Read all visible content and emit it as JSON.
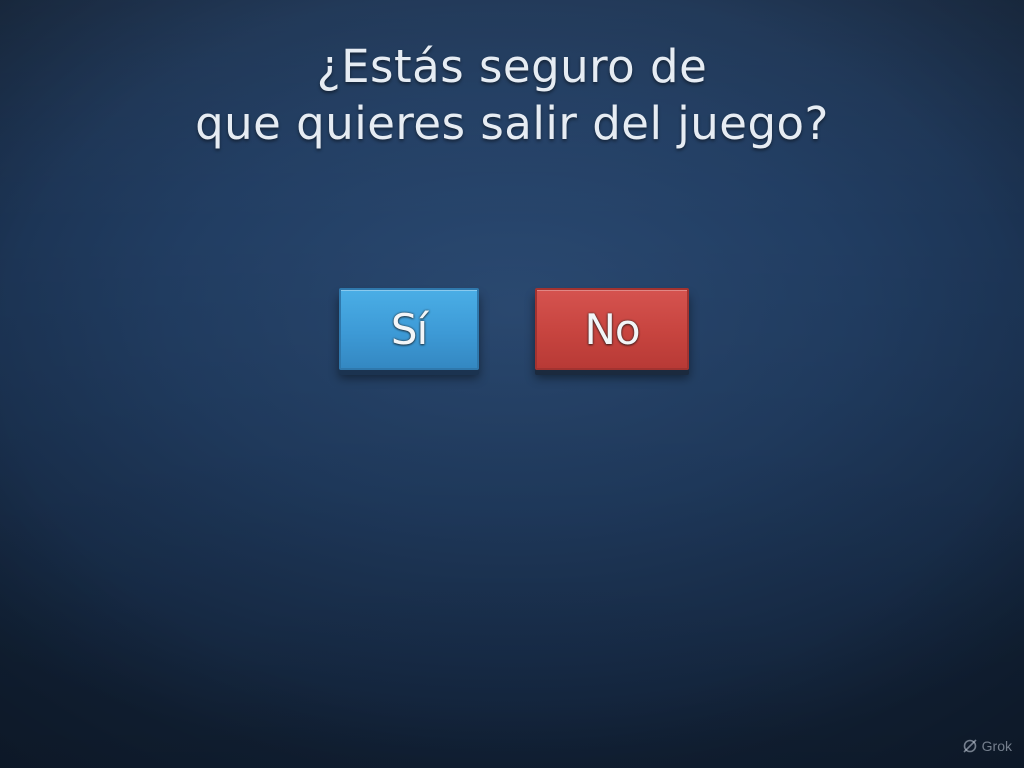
{
  "dialog": {
    "question_line1": "¿Estás seguro de",
    "question_line2": "que quieres salir del juego?",
    "yes_label": "Sí",
    "no_label": "No"
  },
  "watermark": {
    "label": "Grok",
    "icon": "grok-logo-icon"
  },
  "colors": {
    "background": "#213d62",
    "yes_button": "#3d9ad6",
    "no_button": "#c7443f",
    "text": "#e6ecf3"
  }
}
